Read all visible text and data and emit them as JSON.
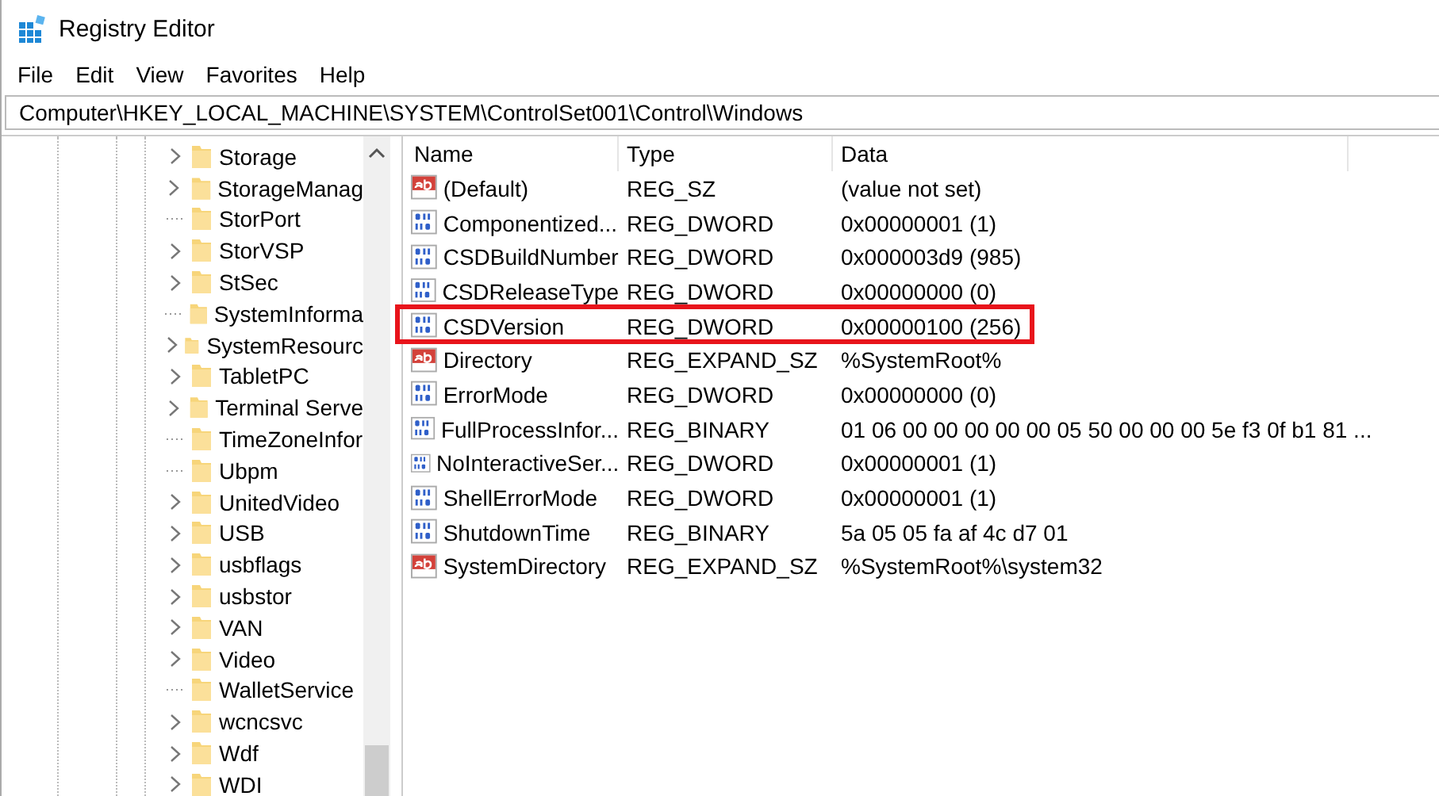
{
  "window": {
    "title": "Registry Editor"
  },
  "menu": [
    "File",
    "Edit",
    "View",
    "Favorites",
    "Help"
  ],
  "address": "Computer\\HKEY_LOCAL_MACHINE\\SYSTEM\\ControlSet001\\Control\\Windows",
  "tree": [
    {
      "label": "Storage",
      "expandable": true
    },
    {
      "label": "StorageManag",
      "expandable": true
    },
    {
      "label": "StorPort",
      "expandable": false
    },
    {
      "label": "StorVSP",
      "expandable": true
    },
    {
      "label": "StSec",
      "expandable": true
    },
    {
      "label": "SystemInforma",
      "expandable": false
    },
    {
      "label": "SystemResourc",
      "expandable": true
    },
    {
      "label": "TabletPC",
      "expandable": true
    },
    {
      "label": "Terminal Serve",
      "expandable": true
    },
    {
      "label": "TimeZoneInfor",
      "expandable": false
    },
    {
      "label": "Ubpm",
      "expandable": false
    },
    {
      "label": "UnitedVideo",
      "expandable": true
    },
    {
      "label": "USB",
      "expandable": true
    },
    {
      "label": "usbflags",
      "expandable": true
    },
    {
      "label": "usbstor",
      "expandable": true
    },
    {
      "label": "VAN",
      "expandable": true
    },
    {
      "label": "Video",
      "expandable": true
    },
    {
      "label": "WalletService",
      "expandable": false
    },
    {
      "label": "wcncsvc",
      "expandable": true
    },
    {
      "label": "Wdf",
      "expandable": true
    },
    {
      "label": "WDI",
      "expandable": true
    }
  ],
  "table": {
    "columns": [
      "Name",
      "Type",
      "Data"
    ],
    "rows": [
      {
        "kind": "string",
        "name": "(Default)",
        "type": "REG_SZ",
        "data": "(value not set)",
        "highlighted": false
      },
      {
        "kind": "number",
        "name": "Componentized...",
        "type": "REG_DWORD",
        "data": "0x00000001 (1)",
        "highlighted": false
      },
      {
        "kind": "number",
        "name": "CSDBuildNumber",
        "type": "REG_DWORD",
        "data": "0x000003d9 (985)",
        "highlighted": false
      },
      {
        "kind": "number",
        "name": "CSDReleaseType",
        "type": "REG_DWORD",
        "data": "0x00000000 (0)",
        "highlighted": false
      },
      {
        "kind": "number",
        "name": "CSDVersion",
        "type": "REG_DWORD",
        "data": "0x00000100 (256)",
        "highlighted": true
      },
      {
        "kind": "string",
        "name": "Directory",
        "type": "REG_EXPAND_SZ",
        "data": "%SystemRoot%",
        "highlighted": false
      },
      {
        "kind": "number",
        "name": "ErrorMode",
        "type": "REG_DWORD",
        "data": "0x00000000 (0)",
        "highlighted": false
      },
      {
        "kind": "number",
        "name": "FullProcessInfor...",
        "type": "REG_BINARY",
        "data": "01 06 00 00 00 00 00 05 50 00 00 00 5e f3 0f b1 81 ...",
        "highlighted": false
      },
      {
        "kind": "number",
        "name": "NoInteractiveSer...",
        "type": "REG_DWORD",
        "data": "0x00000001 (1)",
        "highlighted": false
      },
      {
        "kind": "number",
        "name": "ShellErrorMode",
        "type": "REG_DWORD",
        "data": "0x00000001 (1)",
        "highlighted": false
      },
      {
        "kind": "number",
        "name": "ShutdownTime",
        "type": "REG_BINARY",
        "data": "5a 05 05 fa af 4c d7 01",
        "highlighted": false
      },
      {
        "kind": "string",
        "name": "SystemDirectory",
        "type": "REG_EXPAND_SZ",
        "data": "%SystemRoot%\\system32",
        "highlighted": false
      }
    ]
  }
}
